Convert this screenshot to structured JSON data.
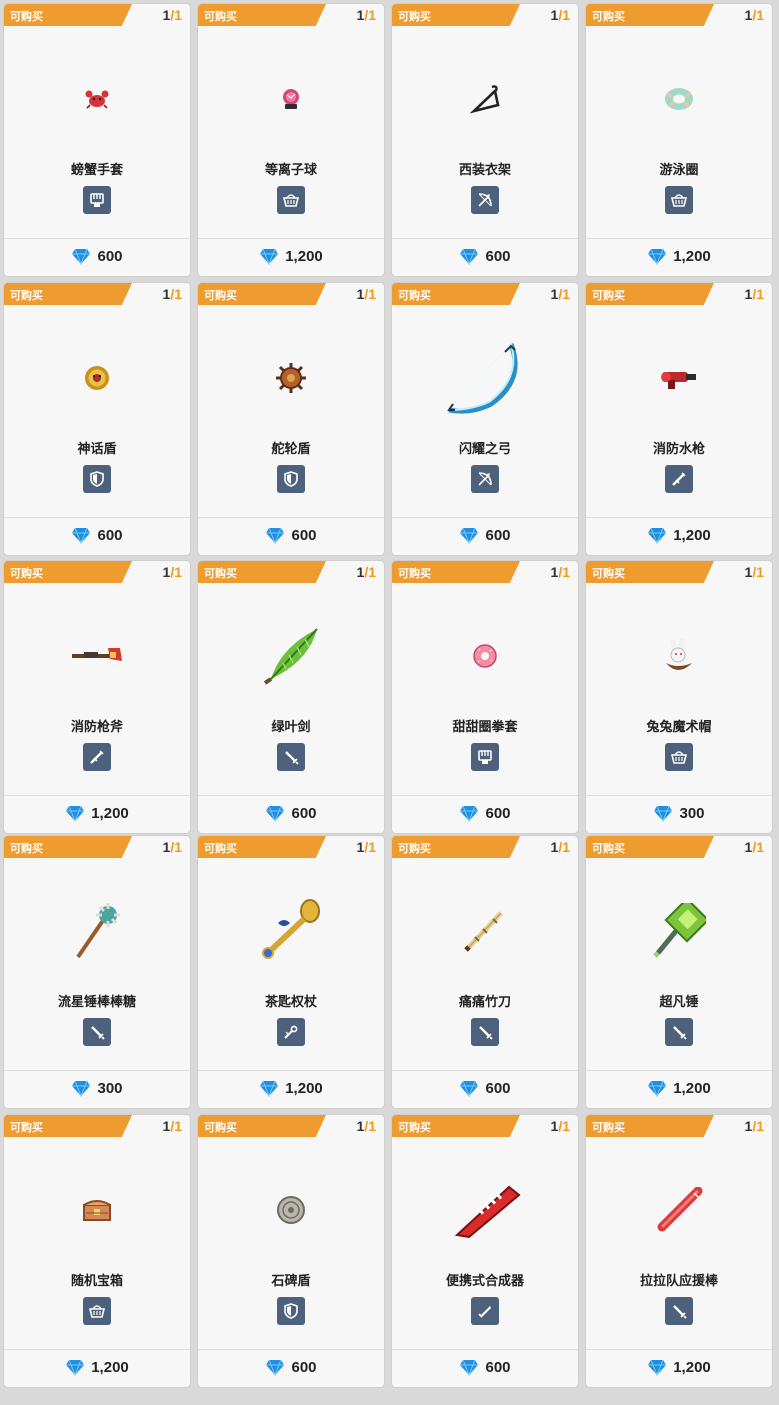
{
  "labels": {
    "buyable": "可购买",
    "stock_current": "1",
    "stock_sep_max": "/1"
  },
  "colors": {
    "ribbon": "#ee9b2f",
    "type_icon_bg": "#4d617d",
    "gem": "#1f8fe0"
  },
  "items": [
    {
      "name": "螃蟹手套",
      "price": "600",
      "type": "fist-icon",
      "art": "crab"
    },
    {
      "name": "等离子球",
      "price": "1,200",
      "type": "basket-icon",
      "art": "plasma"
    },
    {
      "name": "西装衣架",
      "price": "600",
      "type": "bow-icon",
      "art": "hanger"
    },
    {
      "name": "游泳圈",
      "price": "1,200",
      "type": "basket-icon",
      "art": "ring"
    },
    {
      "name": "神话盾",
      "price": "600",
      "type": "shield-icon",
      "art": "mythshield"
    },
    {
      "name": "舵轮盾",
      "price": "600",
      "type": "shield-icon",
      "art": "wheel"
    },
    {
      "name": "闪耀之弓",
      "price": "600",
      "type": "bow-icon",
      "art": "bow"
    },
    {
      "name": "消防水枪",
      "price": "1,200",
      "type": "gun-icon",
      "art": "watergun"
    },
    {
      "name": "消防枪斧",
      "price": "1,200",
      "type": "gun-icon",
      "art": "gunaxe"
    },
    {
      "name": "绿叶剑",
      "price": "600",
      "type": "sword-icon",
      "art": "leaf"
    },
    {
      "name": "甜甜圈拳套",
      "price": "600",
      "type": "fist-icon",
      "art": "donut"
    },
    {
      "name": "兔兔魔术帽",
      "price": "300",
      "type": "basket-icon",
      "art": "bunny"
    },
    {
      "name": "流星锤棒棒糖",
      "price": "300",
      "type": "sword-icon",
      "art": "mace"
    },
    {
      "name": "茶匙权杖",
      "price": "1,200",
      "type": "staff-icon",
      "art": "spoon"
    },
    {
      "name": "痛痛竹刀",
      "price": "600",
      "type": "sword-icon",
      "art": "bamboo"
    },
    {
      "name": "超凡锤",
      "price": "1,200",
      "type": "sword-icon",
      "art": "hammer"
    },
    {
      "name": "随机宝箱",
      "price": "1,200",
      "type": "basket-icon",
      "art": "chest"
    },
    {
      "name": "石碑盾",
      "price": "600",
      "type": "shield-icon",
      "art": "stone"
    },
    {
      "name": "便携式合成器",
      "price": "600",
      "type": "blade-icon",
      "art": "keytar"
    },
    {
      "name": "拉拉队应援棒",
      "price": "1,200",
      "type": "sword-icon",
      "art": "cheer"
    }
  ]
}
